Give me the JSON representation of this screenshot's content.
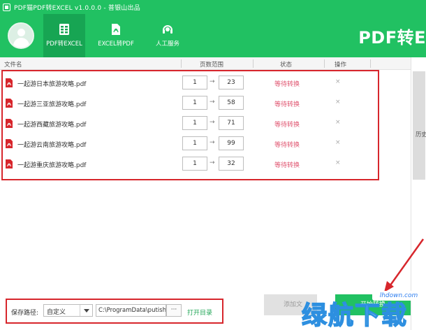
{
  "window": {
    "title": "PDF猫PDF转EXCEL v1.0.0.0 - 普银山出品"
  },
  "nav": {
    "tabs": [
      {
        "label": "PDF转EXCEL",
        "icon": "spreadsheet-icon"
      },
      {
        "label": "EXCEL转PDF",
        "icon": "pdf-icon"
      },
      {
        "label": "人工服务",
        "icon": "headset-icon"
      }
    ]
  },
  "brand": {
    "text": "PDF转E"
  },
  "table": {
    "columns": [
      "文件名",
      "页数范围",
      "状态",
      "操作"
    ],
    "rows": [
      {
        "name": "一起游日本旅游攻略.pdf",
        "from": "1",
        "to": "23",
        "status": "等待转换",
        "action": "×"
      },
      {
        "name": "一起游三亚旅游攻略.pdf",
        "from": "1",
        "to": "58",
        "status": "等待转换",
        "action": "×"
      },
      {
        "name": "一起游西藏旅游攻略.pdf",
        "from": "1",
        "to": "71",
        "status": "等待转换",
        "action": "×"
      },
      {
        "name": "一起游云南旅游攻略.pdf",
        "from": "1",
        "to": "99",
        "status": "等待转换",
        "action": "×"
      },
      {
        "name": "一起游重庆旅游攻略.pdf",
        "from": "1",
        "to": "32",
        "status": "等待转换",
        "action": "×"
      }
    ],
    "arrow": "→"
  },
  "side": {
    "history": "历史"
  },
  "bottom": {
    "save_label": "保存路径:",
    "mode_value": "自定义",
    "path_value": "C:\\ProgramData\\putish",
    "more_label": "···",
    "open_dir": "打开目录",
    "add_label": "添加文",
    "start_label": "开始转换"
  },
  "watermark": {
    "url": "lhdown.com",
    "text": "绿航下载"
  },
  "colors": {
    "brand_green": "#21c162",
    "status_red": "#e05570",
    "annotation_red": "#d7262c"
  }
}
